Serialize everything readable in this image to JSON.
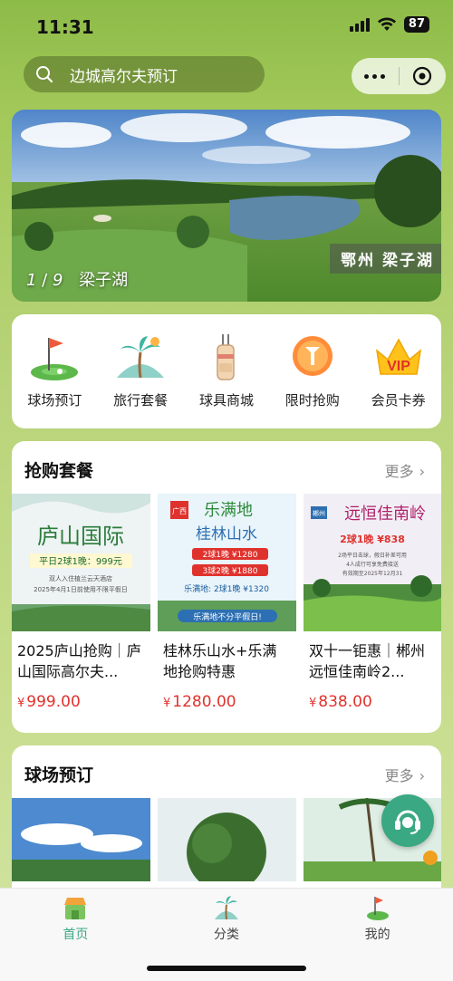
{
  "status_bar": {
    "time": "11:31",
    "battery": "87"
  },
  "search": {
    "text": "边城高尔夫预订"
  },
  "banner": {
    "current": "1",
    "total": "9",
    "name": "梁子湖",
    "tag": "鄂州 梁子湖"
  },
  "menu": [
    {
      "label": "球场预订",
      "icon": "golf-flag-icon"
    },
    {
      "label": "旅行套餐",
      "icon": "palm-tree-icon"
    },
    {
      "label": "球具商城",
      "icon": "golf-bag-icon"
    },
    {
      "label": "限时抢购",
      "icon": "golf-tee-icon"
    },
    {
      "label": "会员卡券",
      "icon": "vip-crown-icon"
    }
  ],
  "deals": {
    "title": "抢购套餐",
    "more": "更多",
    "items": [
      {
        "title": "2025庐山抢购｜庐山国际高尔夫...",
        "price": "999.00",
        "image_text": {
          "name": "庐山国际",
          "offer": "平日2球1晚：999元",
          "line1": "双人入住植兰云天酒店",
          "line2": "2025年4月1日前使用不限平假日"
        }
      },
      {
        "title": "桂林乐山水+乐满地抢购特惠",
        "price": "1280.00",
        "image_text": {
          "name1": "乐满地",
          "name2": "桂林山水",
          "badge": "广西",
          "offer1": "2球1晚 ¥1280",
          "offer2": "3球2晚 ¥1880",
          "offer3": "乐满地: 2球1晚 ¥1320",
          "bottom": "乐满地不分平假日!"
        }
      },
      {
        "title": "双十一钜惠｜郴州远恒佳南岭2...",
        "price": "838.00",
        "image_text": {
          "badge": "郴州",
          "name": "远恒佳南岭",
          "offer": "2球1晚 ¥838",
          "line1": "2场平日击球，假日补差可用",
          "line2": "4人成行可享免费接送",
          "line3": "有效期至2025年12月31"
        }
      }
    ]
  },
  "courts": {
    "title": "球场预订",
    "more": "更多"
  },
  "tabbar": [
    {
      "label": "首页",
      "icon": "home-shop-icon",
      "active": true
    },
    {
      "label": "分类",
      "icon": "category-palm-icon",
      "active": false
    },
    {
      "label": "我的",
      "icon": "profile-golf-icon",
      "active": false
    }
  ],
  "colors": {
    "accent": "#3aa882",
    "price": "#e0322d"
  },
  "currency": "¥"
}
